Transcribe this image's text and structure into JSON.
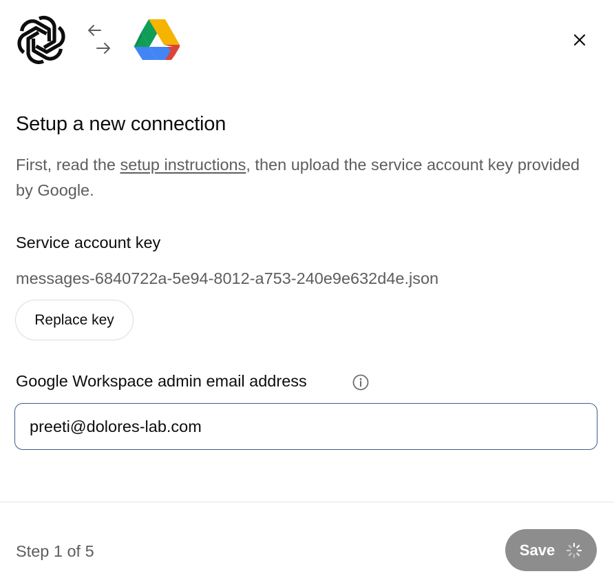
{
  "header": {
    "logo_left_icon": "openai-logo-icon",
    "swap_icon": "swap-arrows-icon",
    "logo_right_icon": "google-drive-logo-icon",
    "close_icon": "close-icon"
  },
  "dialog": {
    "title": "Setup a new connection",
    "description_prefix": "First, read the ",
    "description_link": "setup instructions",
    "description_suffix": ", then upload the service account key provided by Google."
  },
  "service_key": {
    "label": "Service account key",
    "filename": "messages-6840722a-5e94-8012-a753-240e9e632d4e.json",
    "replace_label": "Replace key"
  },
  "admin_email": {
    "label": "Google Workspace admin email address",
    "info_icon": "info-icon",
    "value": "preeti@dolores-lab.com"
  },
  "footer": {
    "step_text": "Step 1 of 5",
    "save_label": "Save",
    "save_icon": "loading-spinner-icon"
  },
  "colors": {
    "text_primary": "#0d0d0d",
    "text_secondary": "#5d5d5d",
    "input_border_focus": "#3d5a8a",
    "save_button_disabled": "#8d8d8d",
    "drive_green": "#0f9d58",
    "drive_yellow": "#f4b400",
    "drive_blue": "#4285f4",
    "drive_red": "#db4437"
  }
}
